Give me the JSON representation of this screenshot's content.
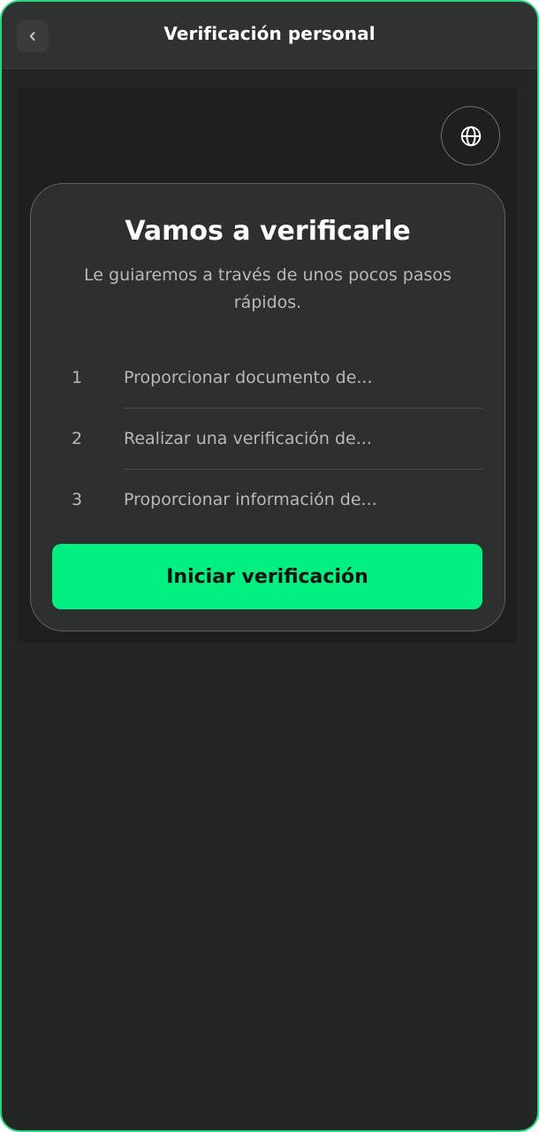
{
  "header": {
    "title": "Verificación personal",
    "back_icon": "chevron-left-icon"
  },
  "language_button": {
    "icon": "globe-icon"
  },
  "card": {
    "title": "Vamos a verificarle",
    "subtitle": "Le guiaremos a través de unos pocos pasos rápidos.",
    "steps": [
      {
        "number": "1",
        "label": "Proporcionar documento de..."
      },
      {
        "number": "2",
        "label": "Realizar una verificación de..."
      },
      {
        "number": "3",
        "label": "Proporcionar información de..."
      }
    ],
    "cta_label": "Iniciar verificación"
  },
  "colors": {
    "accent": "#00ef80",
    "frame_border": "#2bd47f",
    "background": "#242625",
    "card": "#2c302f"
  }
}
